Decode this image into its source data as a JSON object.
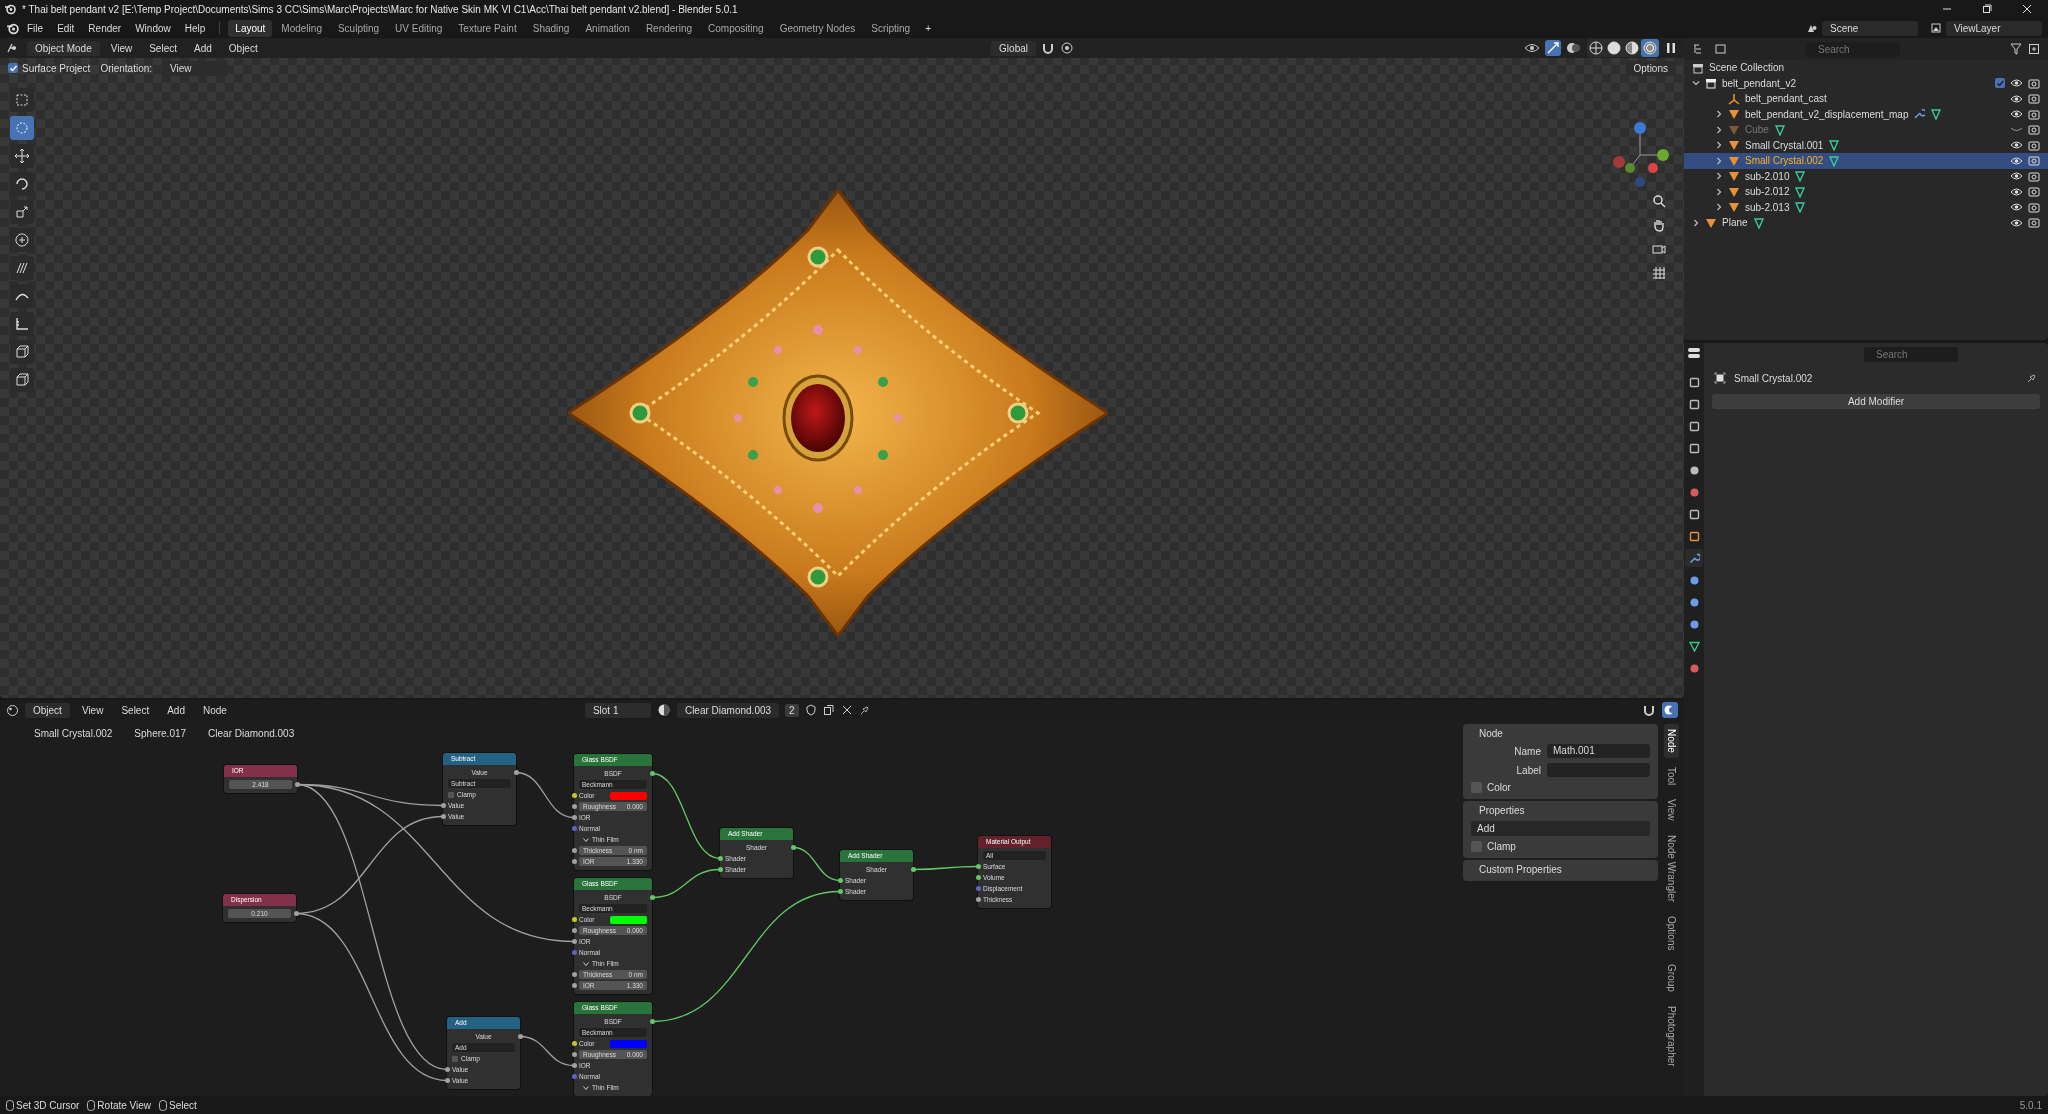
{
  "title_bar": {
    "title": "* Thai belt pendant v2 [E:\\Temp Project\\Documents\\Sims 3 CC\\Sims\\Marc\\Projects\\Marc for Native Skin MK VI C1\\Acc\\Thai belt pendant v2.blend] - Blender 5.0.1"
  },
  "menu": [
    "File",
    "Edit",
    "Render",
    "Window",
    "Help"
  ],
  "workspaces": [
    {
      "label": "Layout",
      "selected": true
    },
    {
      "label": "Modeling",
      "selected": false
    },
    {
      "label": "Sculpting",
      "selected": false
    },
    {
      "label": "UV Editing",
      "selected": false
    },
    {
      "label": "Texture Paint",
      "selected": false
    },
    {
      "label": "Shading",
      "selected": false
    },
    {
      "label": "Animation",
      "selected": false
    },
    {
      "label": "Rendering",
      "selected": false
    },
    {
      "label": "Compositing",
      "selected": false
    },
    {
      "label": "Geometry Nodes",
      "selected": false
    },
    {
      "label": "Scripting",
      "selected": false
    }
  ],
  "add_workspace": "+",
  "scene": {
    "name": "Scene"
  },
  "view_layer": {
    "name": "ViewLayer"
  },
  "viewport": {
    "mode": "Object Mode",
    "menu": [
      "View",
      "Select",
      "Add",
      "Object"
    ],
    "orientation": "Global",
    "surface_project": {
      "label": "Surface Project",
      "checked": true
    },
    "orientation_label": "Orientation:",
    "orientation_value": "View",
    "options": "Options",
    "shading": [
      {
        "kind": "wireframe",
        "selected": false
      },
      {
        "kind": "solid",
        "selected": false
      },
      {
        "kind": "material",
        "selected": false
      },
      {
        "kind": "rendered",
        "selected": true
      }
    ],
    "tools": [
      {
        "kind": "select",
        "selected": false
      },
      {
        "kind": "cursor",
        "selected": true
      },
      {
        "kind": "move",
        "selected": false
      },
      {
        "kind": "rotate",
        "selected": false
      },
      {
        "kind": "scale",
        "selected": false
      },
      {
        "kind": "transform",
        "selected": false
      },
      {
        "kind": "annotate",
        "selected": false
      },
      {
        "kind": "curve",
        "selected": false
      },
      {
        "kind": "measure",
        "selected": false
      },
      {
        "kind": "cube",
        "selected": false
      },
      {
        "kind": "extrude",
        "selected": false
      }
    ]
  },
  "outliner": {
    "search_placeholder": "Search",
    "root": "Scene Collection",
    "items": [
      {
        "name": "belt_pendant_v2",
        "kind": "collection",
        "expanded": true,
        "checked": true,
        "selected": false,
        "hidden": false,
        "children": [
          {
            "name": "belt_pendant_cast",
            "kind": "empty",
            "selected": false,
            "hidden": false,
            "modifier": false
          },
          {
            "name": "belt_pendant_v2_displacement_map",
            "kind": "mesh",
            "expanded": false,
            "selected": false,
            "hidden": false,
            "modifier": true
          },
          {
            "name": "Cube",
            "kind": "mesh",
            "expanded": false,
            "selected": false,
            "hidden": true,
            "modifier": false
          },
          {
            "name": "Small Crystal.001",
            "kind": "mesh",
            "expanded": false,
            "selected": false,
            "hidden": false,
            "modifier": false
          },
          {
            "name": "Small Crystal.002",
            "kind": "mesh",
            "expanded": false,
            "selected": true,
            "hidden": false,
            "modifier": false
          },
          {
            "name": "sub-2.010",
            "kind": "mesh",
            "expanded": false,
            "selected": false,
            "hidden": false,
            "modifier": false
          },
          {
            "name": "sub-2.012",
            "kind": "mesh",
            "expanded": false,
            "selected": false,
            "hidden": false,
            "modifier": false
          },
          {
            "name": "sub-2.013",
            "kind": "mesh",
            "expanded": false,
            "selected": false,
            "hidden": false,
            "modifier": false
          }
        ]
      },
      {
        "name": "Plane",
        "kind": "mesh",
        "expanded": false,
        "selected": false,
        "hidden": false,
        "modifier": false
      }
    ]
  },
  "properties": {
    "search_placeholder": "Search",
    "object": "Small Crystal.002",
    "add_modifier": "Add Modifier",
    "tabs": [
      {
        "kind": "tool",
        "selected": false
      },
      {
        "kind": "render",
        "selected": false
      },
      {
        "kind": "output",
        "selected": false
      },
      {
        "kind": "view_layer",
        "selected": false
      },
      {
        "kind": "scene",
        "selected": false
      },
      {
        "kind": "world",
        "selected": false
      },
      {
        "kind": "collection",
        "selected": false
      },
      {
        "kind": "object",
        "selected": false
      },
      {
        "kind": "modifiers",
        "selected": true
      },
      {
        "kind": "particles",
        "selected": false
      },
      {
        "kind": "physics",
        "selected": false
      },
      {
        "kind": "constraints",
        "selected": false
      },
      {
        "kind": "data",
        "selected": false
      },
      {
        "kind": "material",
        "selected": false
      }
    ]
  },
  "node_editor": {
    "type": "Object",
    "menu": [
      "View",
      "Select",
      "Add",
      "Node"
    ],
    "slot": "Slot 1",
    "material": "Clear Diamond.003",
    "users": "2",
    "breadcrumb": [
      "Small Crystal.002",
      "Sphere.017",
      "Clear Diamond.003"
    ],
    "nodes": [
      {
        "kind": "input",
        "title": "IOR",
        "rows": [
          {
            "kind": "value",
            "value": "2.418",
            "socket": {
              "color": "#a1a1a1"
            }
          }
        ]
      },
      {
        "kind": "input",
        "title": "Dispersion",
        "rows": [
          {
            "kind": "value",
            "value": "0.210",
            "socket": {
              "color": "#a1a1a1"
            }
          }
        ]
      },
      {
        "kind": "math",
        "title": "Subtract",
        "rows": [
          {
            "kind": "output",
            "label": "Value",
            "socket": {
              "color": "#a1a1a1"
            }
          },
          {
            "kind": "select",
            "value": "Subtract"
          },
          {
            "kind": "checkbox",
            "label": "Clamp",
            "checked": false
          },
          {
            "kind": "input",
            "label": "Value",
            "socket": {
              "color": "#a1a1a1"
            }
          },
          {
            "kind": "input",
            "label": "Value",
            "socket": {
              "color": "#a1a1a1"
            }
          }
        ]
      },
      {
        "kind": "math",
        "title": "Add",
        "rows": [
          {
            "kind": "output",
            "label": "Value",
            "socket": {
              "color": "#a1a1a1"
            }
          },
          {
            "kind": "select",
            "value": "Add"
          },
          {
            "kind": "checkbox",
            "label": "Clamp",
            "checked": false
          },
          {
            "kind": "input",
            "label": "Value",
            "socket": {
              "color": "#a1a1a1"
            }
          },
          {
            "kind": "input",
            "label": "Value",
            "socket": {
              "color": "#a1a1a1"
            }
          }
        ]
      },
      {
        "kind": "shader",
        "title": "Glass BSDF",
        "rows": [
          {
            "kind": "output",
            "label": "BSDF",
            "socket": {
              "color": "#63c763"
            }
          },
          {
            "kind": "select",
            "value": "Beckmann"
          },
          {
            "kind": "color",
            "label": "Color",
            "socket": {
              "color": "#c7c729"
            },
            "color": "#ff0000"
          },
          {
            "kind": "field",
            "label": "Roughness",
            "value": "0.000",
            "socket": {
              "color": "#a1a1a1"
            }
          },
          {
            "kind": "input",
            "label": "IOR",
            "socket": {
              "color": "#a1a1a1"
            }
          },
          {
            "kind": "input",
            "label": "Normal",
            "socket": {
              "color": "#6363c7"
            }
          },
          {
            "kind": "panel",
            "label": "Thin Film",
            "expanded": true
          },
          {
            "kind": "field",
            "label": "Thickness",
            "value": "0 nm",
            "socket": {
              "color": "#a1a1a1"
            }
          },
          {
            "kind": "field",
            "label": "IOR",
            "value": "1.330",
            "socket": {
              "color": "#a1a1a1"
            }
          }
        ]
      },
      {
        "kind": "shader",
        "title": "Glass BSDF",
        "rows": [
          {
            "kind": "output",
            "label": "BSDF",
            "socket": {
              "color": "#63c763"
            }
          },
          {
            "kind": "select",
            "value": "Beckmann"
          },
          {
            "kind": "color",
            "label": "Color",
            "socket": {
              "color": "#c7c729"
            },
            "color": "#00ff00"
          },
          {
            "kind": "field",
            "label": "Roughness",
            "value": "0.000",
            "socket": {
              "color": "#a1a1a1"
            }
          },
          {
            "kind": "input",
            "label": "IOR",
            "socket": {
              "color": "#a1a1a1"
            }
          },
          {
            "kind": "input",
            "label": "Normal",
            "socket": {
              "color": "#6363c7"
            }
          },
          {
            "kind": "panel",
            "label": "Thin Film",
            "expanded": true
          },
          {
            "kind": "field",
            "label": "Thickness",
            "value": "0 nm",
            "socket": {
              "color": "#a1a1a1"
            }
          },
          {
            "kind": "field",
            "label": "IOR",
            "value": "1.330",
            "socket": {
              "color": "#a1a1a1"
            }
          }
        ]
      },
      {
        "kind": "shader",
        "title": "Glass BSDF",
        "rows": [
          {
            "kind": "output",
            "label": "BSDF",
            "socket": {
              "color": "#63c763"
            }
          },
          {
            "kind": "select",
            "value": "Beckmann"
          },
          {
            "kind": "color",
            "label": "Color",
            "socket": {
              "color": "#c7c729"
            },
            "color": "#0000ff"
          },
          {
            "kind": "field",
            "label": "Roughness",
            "value": "0.000",
            "socket": {
              "color": "#a1a1a1"
            }
          },
          {
            "kind": "input",
            "label": "IOR",
            "socket": {
              "color": "#a1a1a1"
            }
          },
          {
            "kind": "input",
            "label": "Normal",
            "socket": {
              "color": "#6363c7"
            }
          },
          {
            "kind": "panel",
            "label": "Thin Film",
            "expanded": true
          }
        ]
      },
      {
        "kind": "shader",
        "title": "Add Shader",
        "rows": [
          {
            "kind": "output",
            "label": "Shader",
            "socket": {
              "color": "#63c763"
            }
          },
          {
            "kind": "input",
            "label": "Shader",
            "socket": {
              "color": "#63c763"
            }
          },
          {
            "kind": "input",
            "label": "Shader",
            "socket": {
              "color": "#63c763"
            }
          }
        ]
      },
      {
        "kind": "shader",
        "title": "Add Shader",
        "rows": [
          {
            "kind": "output",
            "label": "Shader",
            "socket": {
              "color": "#63c763"
            }
          },
          {
            "kind": "input",
            "label": "Shader",
            "socket": {
              "color": "#63c763"
            }
          },
          {
            "kind": "input",
            "label": "Shader",
            "socket": {
              "color": "#63c763"
            }
          }
        ]
      },
      {
        "kind": "output",
        "title": "Material Output",
        "rows": [
          {
            "kind": "select",
            "value": "All"
          },
          {
            "kind": "input",
            "label": "Surface",
            "socket": {
              "color": "#63c763"
            }
          },
          {
            "kind": "input",
            "label": "Volume",
            "socket": {
              "color": "#63c763"
            }
          },
          {
            "kind": "input",
            "label": "Displacement",
            "socket": {
              "color": "#6363c7"
            }
          },
          {
            "kind": "input",
            "label": "Thickness",
            "socket": {
              "color": "#a1a1a1"
            }
          }
        ]
      }
    ]
  },
  "sidebar": {
    "tabs": [
      {
        "label": "Node",
        "selected": true
      },
      {
        "label": "Tool",
        "selected": false
      },
      {
        "label": "View",
        "selected": false
      },
      {
        "label": "Node Wrangler",
        "selected": false
      },
      {
        "label": "Options",
        "selected": false
      },
      {
        "label": "Group",
        "selected": false
      },
      {
        "label": "Photographer",
        "selected": false
      }
    ],
    "node_panel": {
      "title": "Node",
      "name_label": "Name",
      "name": "Math.001",
      "label_label": "Label",
      "color_label": "Color",
      "color_checked": false
    },
    "properties_panel": {
      "title": "Properties",
      "operation": "Add",
      "clamp_label": "Clamp",
      "clamp": false
    },
    "custom_properties": {
      "title": "Custom Properties"
    }
  },
  "status_bar": {
    "hints": [
      "Set 3D Cursor",
      "Rotate View",
      "Select"
    ],
    "version": "5.0.1"
  }
}
